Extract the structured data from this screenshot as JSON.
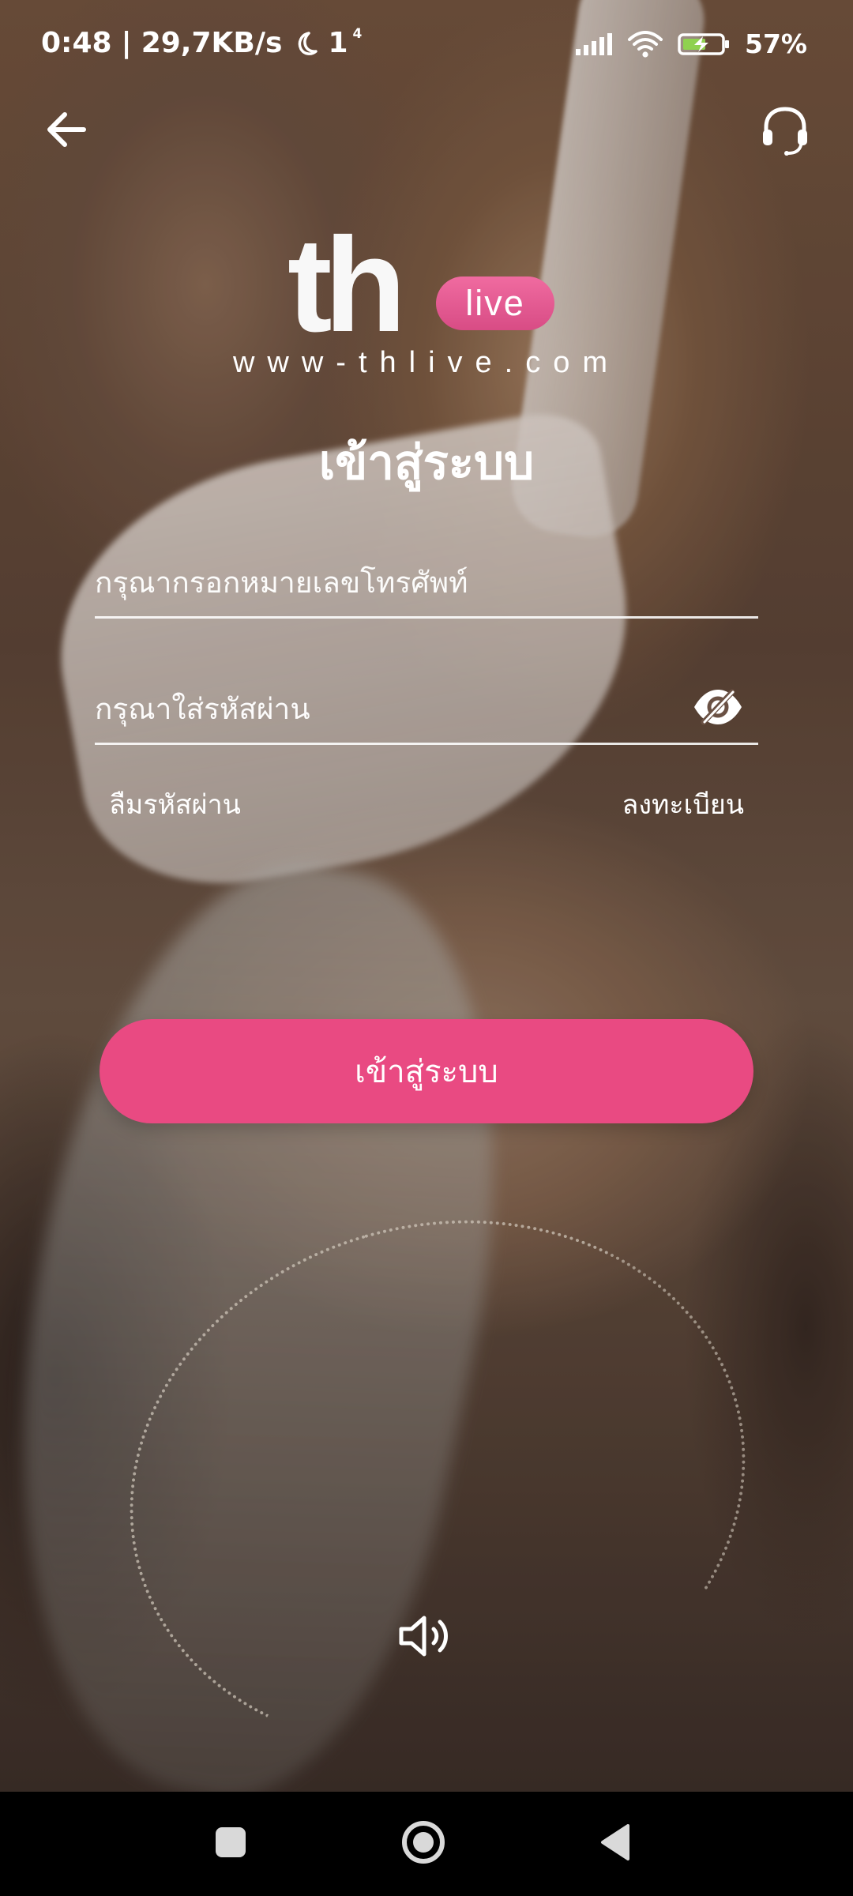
{
  "status_bar": {
    "time": "0:48",
    "separator": "|",
    "network_speed": "29,7KB/s",
    "notification_count": "1",
    "notification_superscript": "4",
    "battery_percent": "57",
    "battery_percent_suffix": "%",
    "icons": {
      "moon": "moon-icon",
      "signal": "signal-icon",
      "wifi": "wifi-icon",
      "battery": "battery-charging-icon"
    }
  },
  "header": {
    "back_icon": "arrow-left-icon",
    "support_icon": "headset-icon"
  },
  "logo": {
    "brand": "th",
    "badge": "live",
    "url": "www-thlive.com"
  },
  "login_form": {
    "title": "เข้าสู่ระบบ",
    "phone_placeholder": "กรุณากรอกหมายเลขโทรศัพท์",
    "phone_value": "",
    "password_placeholder": "กรุณาใส่รหัสผ่าน",
    "password_value": "",
    "password_visibility_icon": "eye-off-icon",
    "forgot_password": "ลืมรหัสผ่าน",
    "register": "ลงทะเบียน",
    "submit_label": "เข้าสู่ระบบ"
  },
  "media": {
    "sound_icon": "speaker-icon"
  },
  "navigation_bar": {
    "recents_icon": "square-icon",
    "home_icon": "circle-icon",
    "back_icon": "triangle-back-icon"
  },
  "colors": {
    "accent": "#e94a82",
    "logo_badge": "#f06ba0",
    "text": "#ffffff",
    "navigation_bar": "#000000"
  }
}
